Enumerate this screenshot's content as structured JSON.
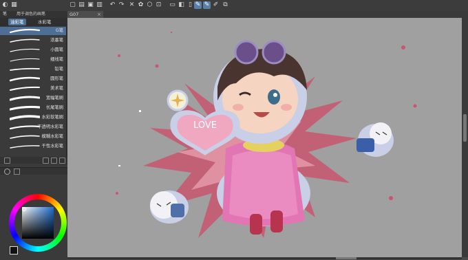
{
  "toolbar": {
    "icons": [
      "palette-icon",
      "new-file-icon",
      "open-icon",
      "save-icon",
      "undo-icon",
      "redo-icon",
      "clear-icon",
      "fill-icon",
      "transform-icon",
      "select-icon",
      "flip-icon",
      "snap-icon",
      "ruler-icon",
      "pen-icon",
      "pen-alt-icon",
      "pen-wide-icon",
      "layer-icon"
    ]
  },
  "left_panel": {
    "subtabs": [
      "笔",
      "用于调色的画笔"
    ],
    "brush_tabs": [
      "油彩笔",
      "水彩笔"
    ],
    "brushes": [
      {
        "name": "G笔",
        "selected": true
      },
      {
        "name": "浓墨笔",
        "selected": false
      },
      {
        "name": "小圆笔",
        "selected": false
      },
      {
        "name": "细线笔",
        "selected": false
      },
      {
        "name": "铅笔",
        "selected": false
      },
      {
        "name": "圆形笔",
        "selected": false
      },
      {
        "name": "美术笔",
        "selected": false
      },
      {
        "name": "宽幅笔刷",
        "selected": false
      },
      {
        "name": "长尾笔刷",
        "selected": false
      },
      {
        "name": "水彩软笔刷",
        "selected": false
      },
      {
        "name": "不透明水彩笔",
        "selected": false
      },
      {
        "name": "模糊水彩笔",
        "selected": false
      },
      {
        "name": "干性水彩笔",
        "selected": false
      }
    ]
  },
  "document": {
    "tab_title": "G07",
    "close_symbol": "×"
  },
  "artwork": {
    "heart_text": "LOVE"
  },
  "colors": {
    "accent": "#4e6f95",
    "canvas_bg": "#a0a0a0",
    "splash": "#c8566e",
    "dress": "#e276b4"
  }
}
